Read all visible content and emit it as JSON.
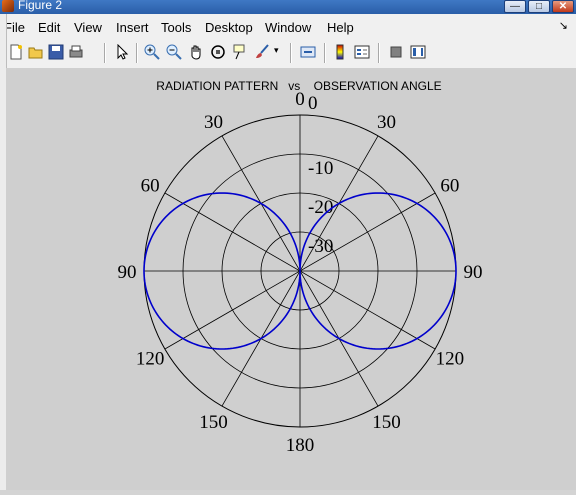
{
  "window": {
    "title": "Figure 2",
    "min_label": "—",
    "max_label": "□",
    "close_label": "✕"
  },
  "menu": {
    "items": [
      "File",
      "Edit",
      "View",
      "Insert",
      "Tools",
      "Desktop",
      "Window",
      "Help"
    ],
    "arrow": "↘"
  },
  "toolbar": {
    "icons": [
      "new-figure-icon",
      "open-file-icon",
      "save-icon",
      "print-icon",
      "edit-plot-icon",
      "zoom-in-icon",
      "zoom-out-icon",
      "pan-icon",
      "rotate-3d-icon",
      "data-cursor-icon",
      "brush-icon",
      "link-plot-icon",
      "insert-colorbar-icon",
      "insert-legend-icon",
      "hide-plot-tools-icon",
      "show-plot-tools-icon"
    ]
  },
  "plot": {
    "title": "RADIATION PATTERN   vs    OBSERVATION ANGLE",
    "line_color": "#0000cc",
    "angle_labels": {
      "0": "0",
      "30": "30",
      "60": "60",
      "90": "90",
      "120": "120",
      "150": "150",
      "180": "180",
      "210": "150",
      "240": "120",
      "270": "90",
      "300": "60",
      "330": "30"
    },
    "radial_labels": [
      "0",
      "-10",
      "-20",
      "-30"
    ]
  },
  "chart_data": {
    "type": "line",
    "subtype": "polar",
    "title": "RADIATION PATTERN   vs    OBSERVATION ANGLE",
    "theta_ticks_deg": [
      0,
      30,
      60,
      90,
      120,
      150,
      180,
      150,
      120,
      90,
      60,
      30
    ],
    "r_ticks": [
      0,
      -10,
      -20,
      -30
    ],
    "rlim": [
      -40,
      0
    ],
    "series": [
      {
        "color": "#0000cc",
        "formula": "sin(theta) (dipole pattern)",
        "theta_deg": [
          0,
          15,
          30,
          45,
          60,
          75,
          90,
          105,
          120,
          135,
          150,
          165,
          180
        ],
        "r_norm": [
          0.0,
          0.26,
          0.5,
          0.71,
          0.87,
          0.97,
          1.0,
          0.97,
          0.87,
          0.71,
          0.5,
          0.26,
          0.0
        ]
      }
    ]
  }
}
